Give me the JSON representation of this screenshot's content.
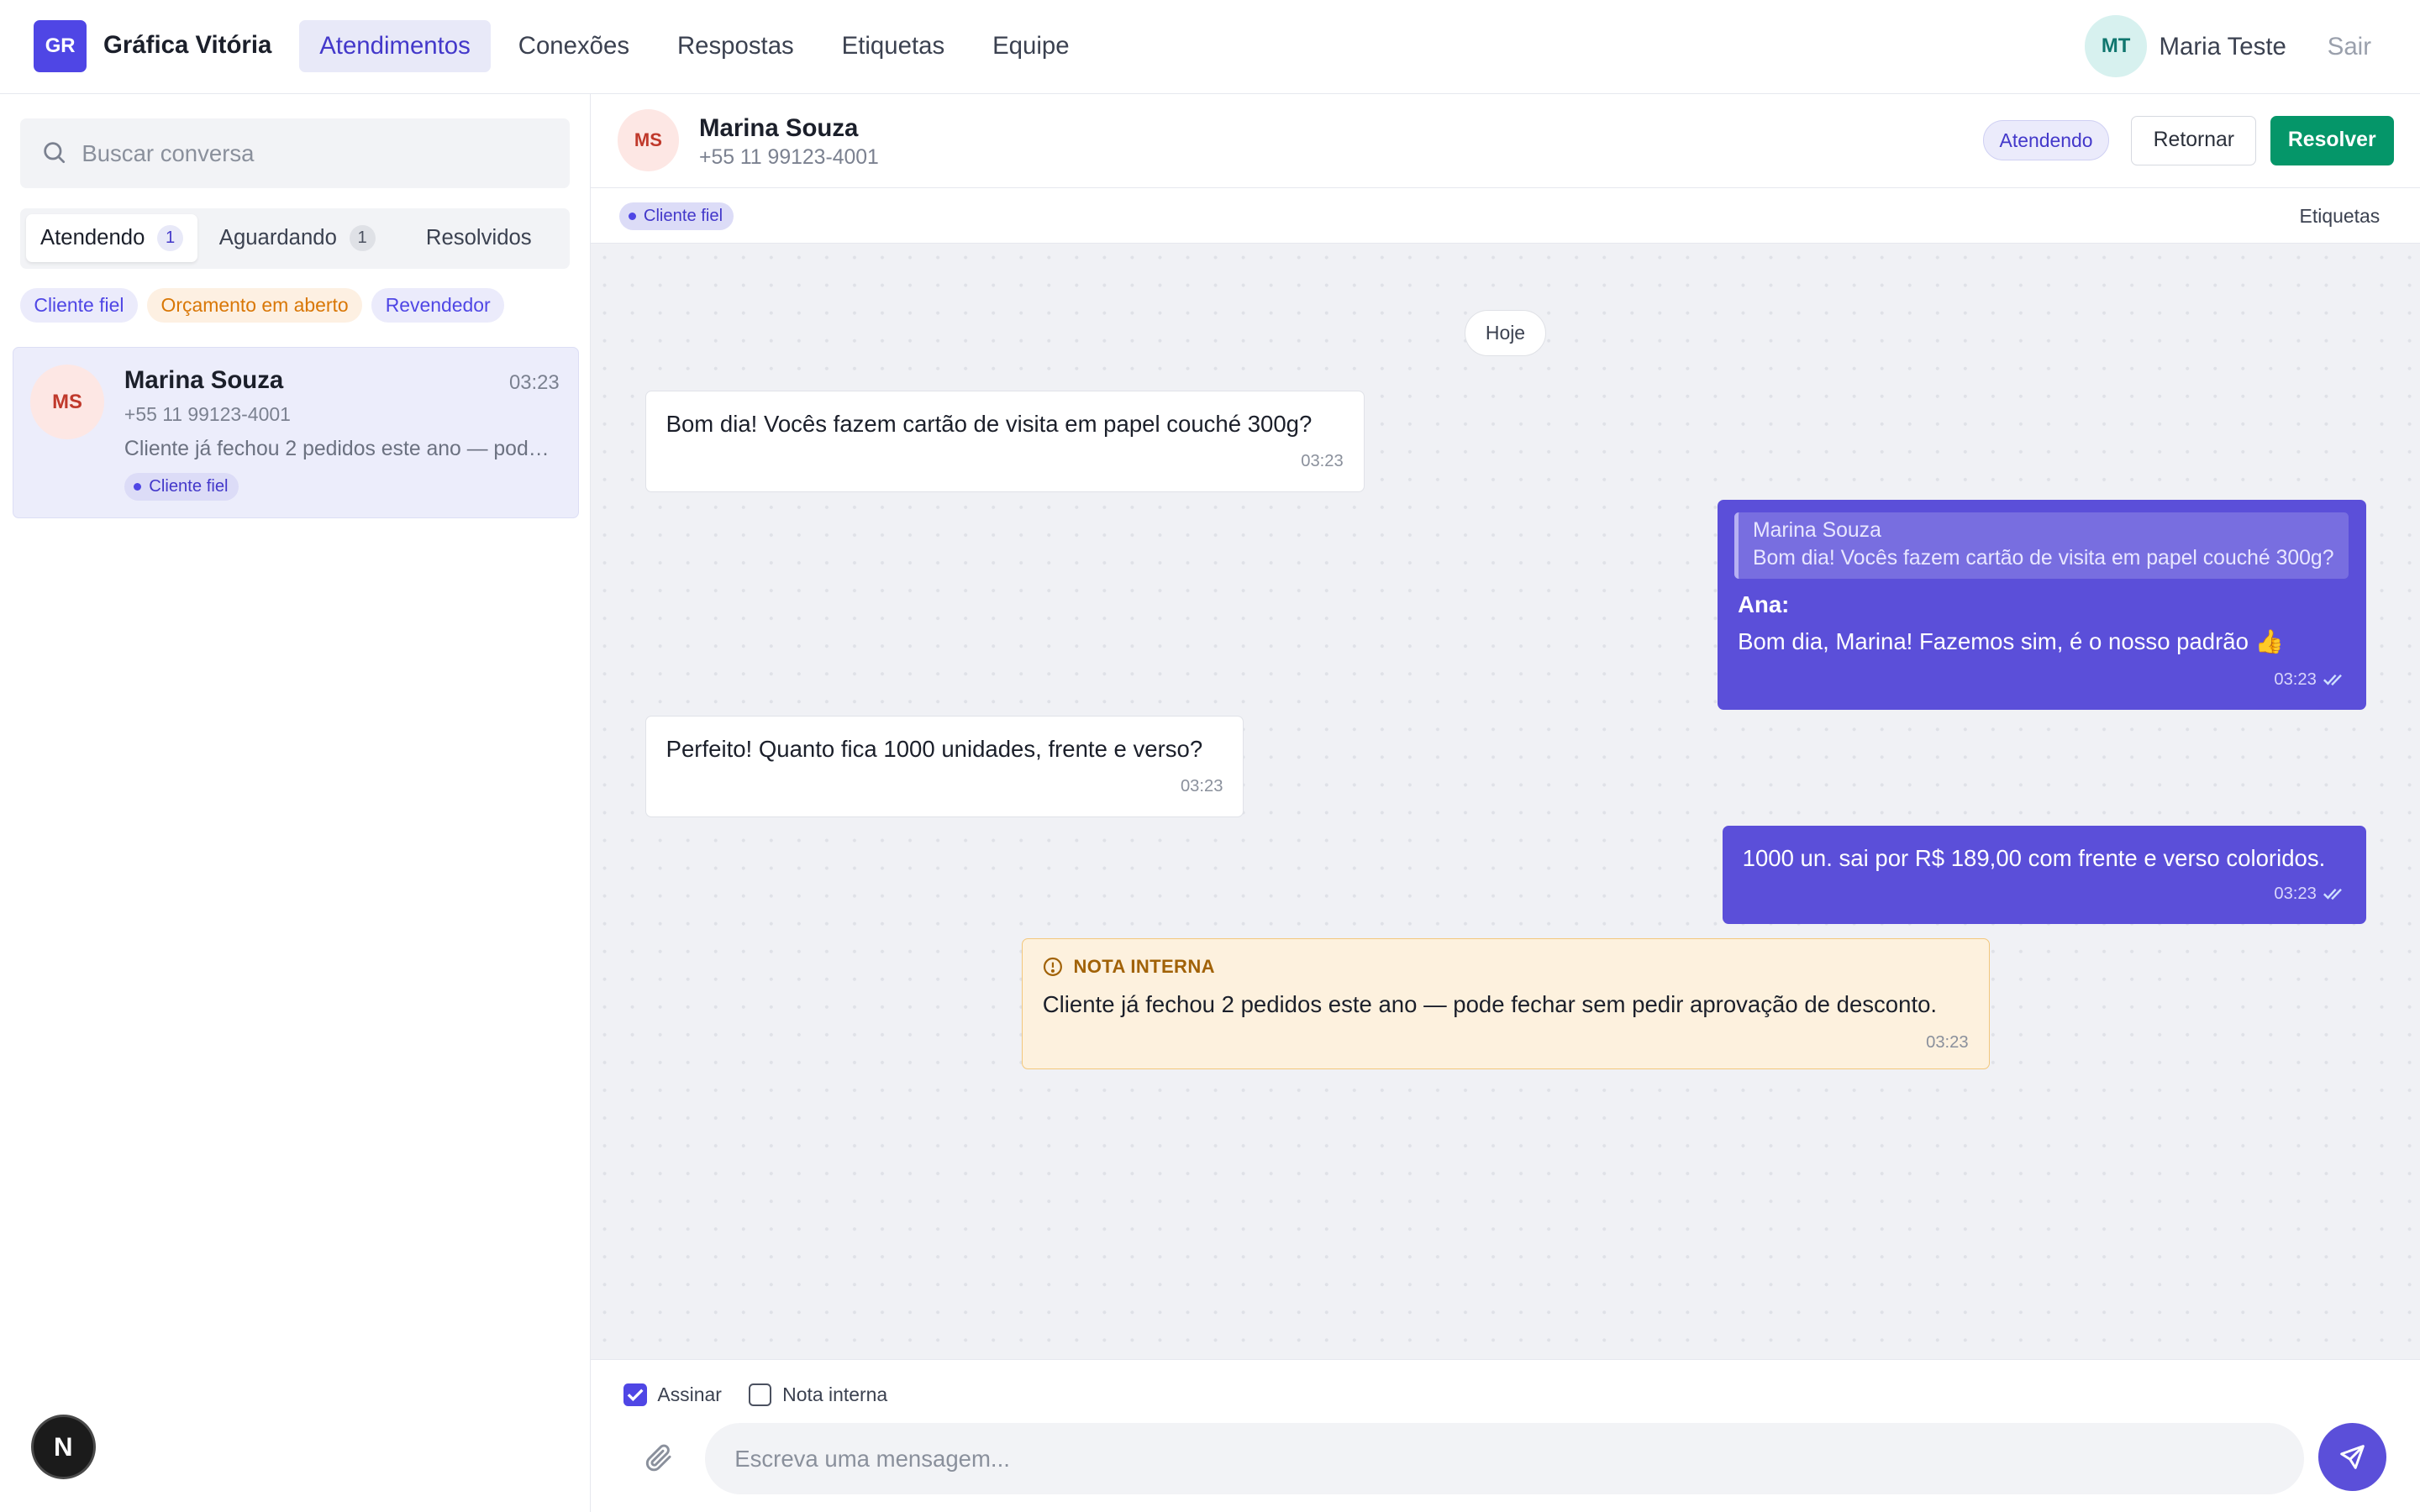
{
  "app": {
    "logo_initials": "GR",
    "brand": "Gráfica Vitória",
    "nav": [
      "Atendimentos",
      "Conexões",
      "Respostas",
      "Etiquetas",
      "Equipe"
    ],
    "active_nav": "Atendimentos",
    "user_initials": "MT",
    "user_name": "Maria Teste",
    "logout": "Sair",
    "accent": "#4f46e5"
  },
  "sidebar": {
    "search_placeholder": "Buscar conversa",
    "tabs": [
      {
        "label": "Atendendo",
        "count": "1"
      },
      {
        "label": "Aguardando",
        "count": "1"
      },
      {
        "label": "Resolvidos"
      }
    ],
    "filters": [
      "Cliente fiel",
      "Orçamento em aberto",
      "Revendedor"
    ],
    "conversations": [
      {
        "initials": "MS",
        "name": "Marina Souza",
        "time": "03:23",
        "phone": "+55 11 99123-4001",
        "preview": "Cliente já fechou 2 pedidos este ano — pode fechar sem pedir aprovação de desconto.",
        "tag": "Cliente fiel"
      }
    ],
    "framework_badge": "N"
  },
  "chat": {
    "contact_initials": "MS",
    "contact_name": "Marina Souza",
    "contact_phone": "+55 11 99123-4001",
    "status": "Atendendo",
    "return_label": "Retornar",
    "resolve_label": "Resolver",
    "resolve_color": "#059669",
    "tag": "Cliente fiel",
    "tags_link": "Etiquetas",
    "day": "Hoje",
    "messages": [
      {
        "text": "Bom dia! Vocês fazem cartão de visita em papel couché 300g?",
        "time": "03:23"
      },
      {
        "quote_author": "Marina Souza",
        "quote_text": "Bom dia! Vocês fazem cartão de visita em papel couché 300g?",
        "sender": "Ana:",
        "text": "Bom dia, Marina! Fazemos sim, é o nosso padrão 👍",
        "time": "03:23"
      },
      {
        "text": "Perfeito! Quanto fica 1000 unidades, frente e verso?",
        "time": "03:23"
      },
      {
        "text": "1000 un. sai por R$ 189,00 com frente e verso coloridos.",
        "time": "03:23"
      }
    ],
    "note": {
      "title": "NOTA INTERNA",
      "text": "Cliente já fechou 2 pedidos este ano — pode fechar sem pedir aprovação de desconto.",
      "time": "03:23"
    },
    "composer": {
      "sign_label": "Assinar",
      "sign_checked": true,
      "internal_label": "Nota interna",
      "internal_checked": false,
      "placeholder": "Escreva uma mensagem..."
    }
  }
}
